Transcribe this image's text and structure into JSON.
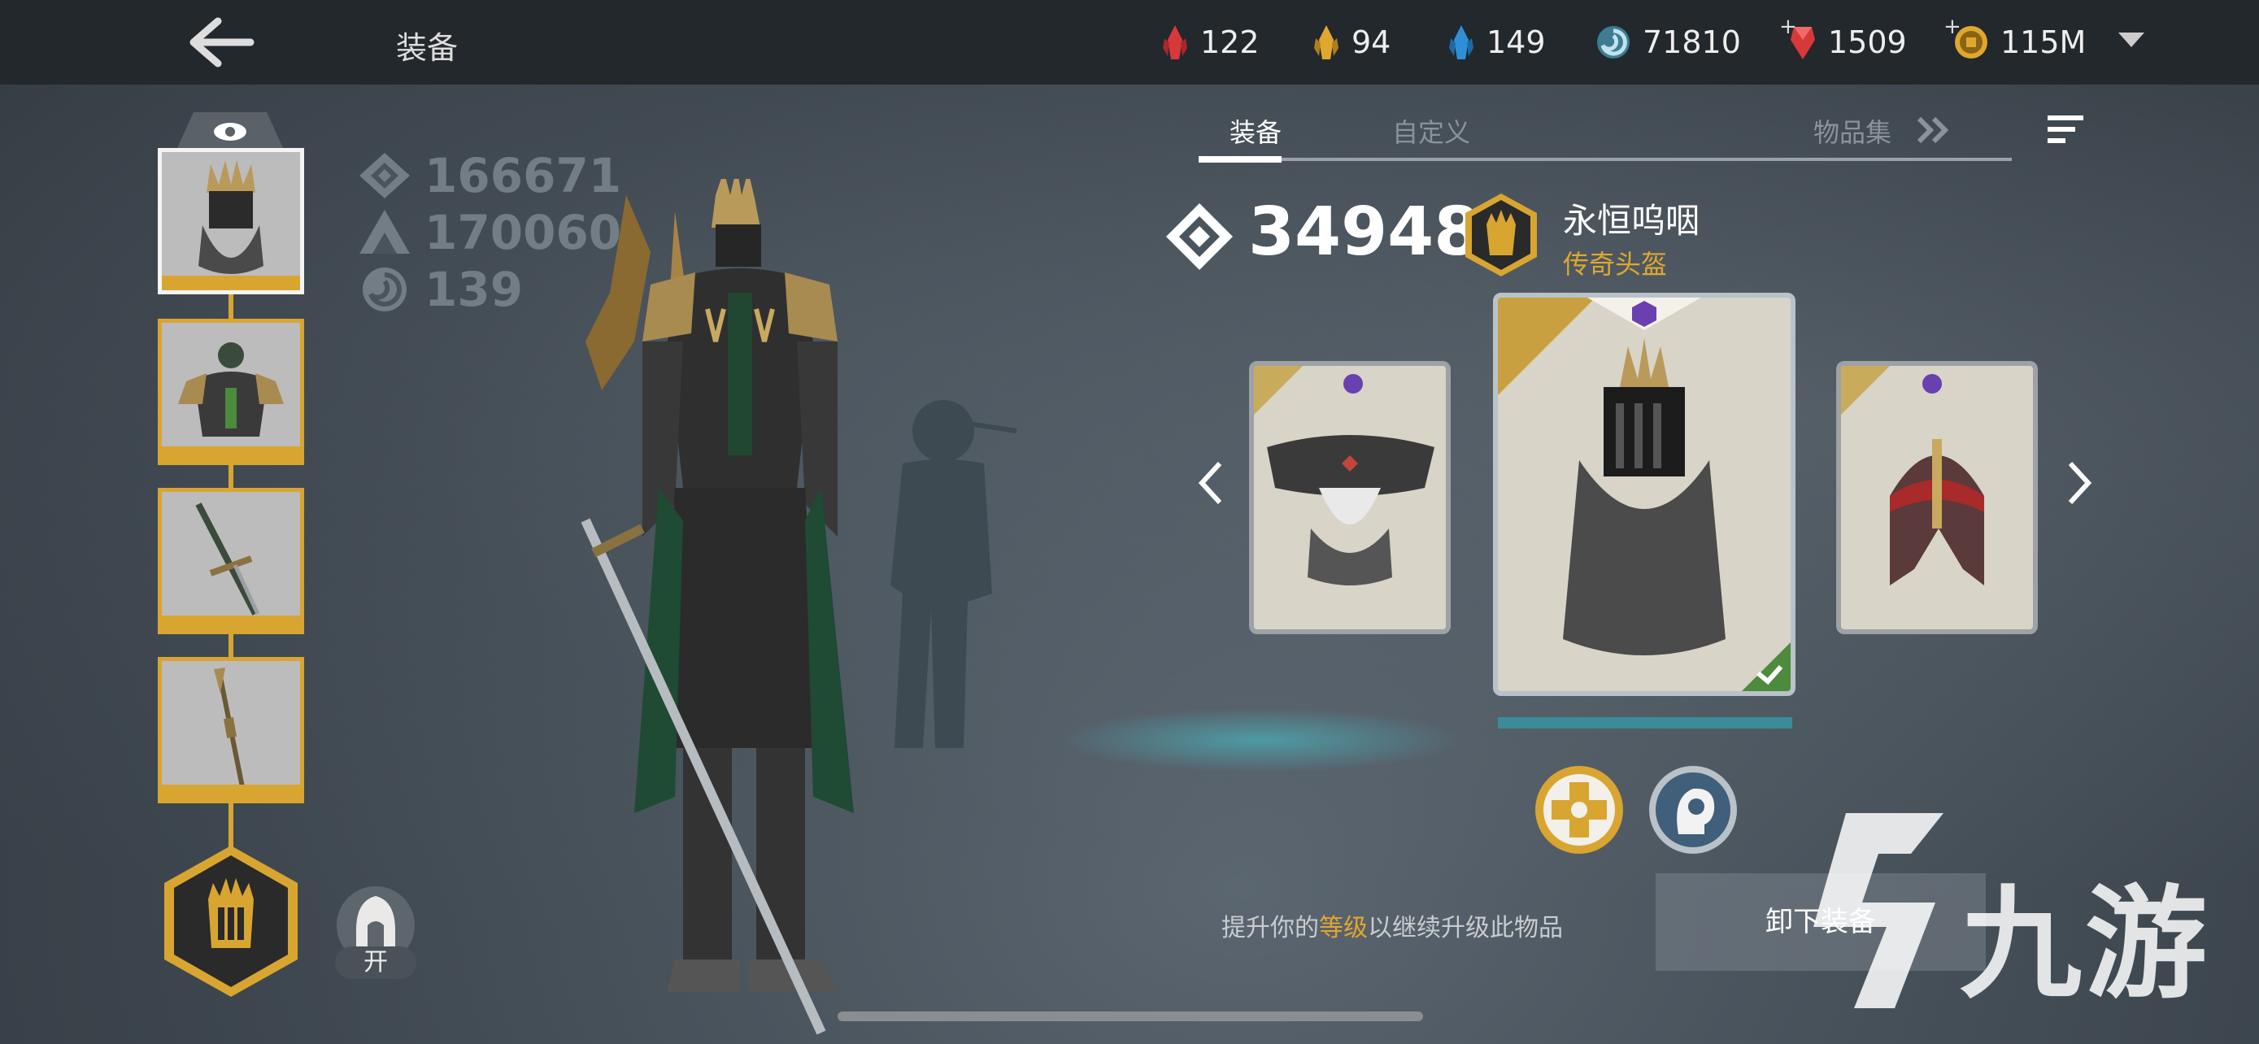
{
  "header": {
    "title": "装备",
    "resources": [
      {
        "name": "red-shard",
        "value": "122",
        "color": "#d9383a",
        "plus": ""
      },
      {
        "name": "gold-shard",
        "value": "94",
        "color": "#e0a72f",
        "plus": ""
      },
      {
        "name": "blue-shard",
        "value": "149",
        "color": "#2f8fd6",
        "plus": ""
      },
      {
        "name": "spiral-orb",
        "value": "71810",
        "color": "#5fb0c8",
        "plus": ""
      },
      {
        "name": "ruby-gem",
        "value": "1509",
        "color": "#d9383a",
        "plus": "+"
      },
      {
        "name": "coin",
        "value": "115M",
        "color": "#e0a72f",
        "plus": "+"
      }
    ]
  },
  "stats": {
    "power_total": "166671",
    "power_max": "170060",
    "level": "139"
  },
  "tabs": {
    "equip": "装备",
    "custom": "自定义",
    "collection": "物品集"
  },
  "item": {
    "power": "34948",
    "name": "永恒呜咽",
    "type": "传奇头盔"
  },
  "hood_toggle": "开",
  "hint": {
    "prefix": "提升你的",
    "highlight": "等级",
    "suffix": "以继续升级此物品"
  },
  "unequip": "卸下装备",
  "watermark": "九游",
  "colors": {
    "accent_gold": "#d9a531",
    "legendary": "#e0a72f",
    "equipped_green": "#4c8a3c"
  }
}
